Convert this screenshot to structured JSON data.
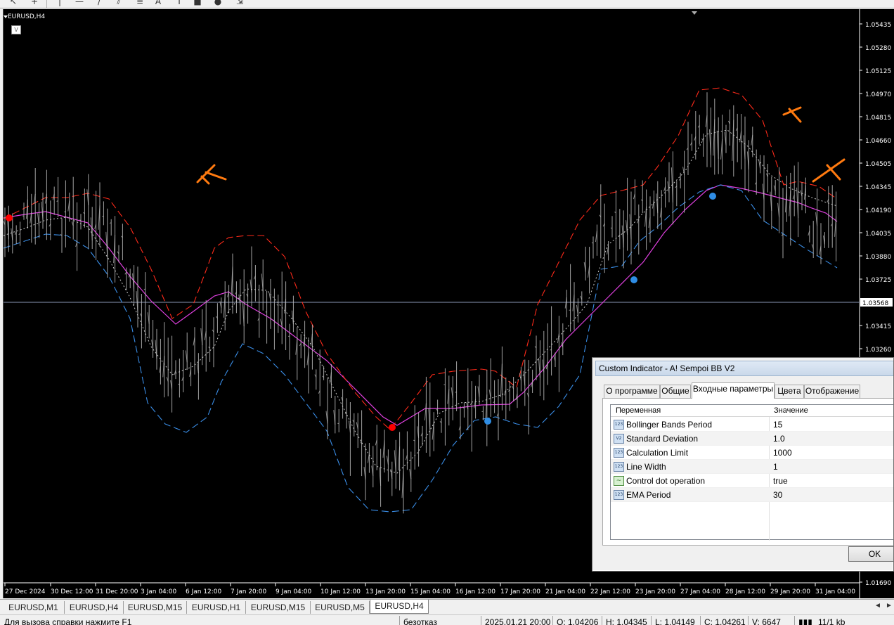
{
  "toolbar": {
    "buttons": [
      {
        "icon": "cursor-icon"
      },
      {
        "icon": "crosshair-icon"
      },
      {
        "icon": "vertical-line-icon"
      },
      {
        "icon": "horizontal-line-icon"
      },
      {
        "icon": "trendline-icon"
      },
      {
        "icon": "equidistant-channel-icon"
      },
      {
        "icon": "fibonacci-icon"
      },
      {
        "icon": "text-icon"
      },
      {
        "icon": "label-icon"
      },
      {
        "icon": "rectangle-icon"
      },
      {
        "icon": "ellipse-icon"
      },
      {
        "icon": "arrows-icon"
      }
    ]
  },
  "chart": {
    "symbol": "EURUSD,H4",
    "one_click_label": "V",
    "current_price": "1.03568",
    "price_axis": [
      "1.05435",
      "1.05280",
      "1.05125",
      "1.04970",
      "1.04815",
      "1.04660",
      "1.04505",
      "1.04345",
      "1.04190",
      "1.04035",
      "1.03880",
      "1.03725",
      "1.03568",
      "1.03415",
      "1.03260",
      "1.01690"
    ],
    "time_axis": [
      "27 Dec 2024",
      "30 Dec 12:00",
      "31 Dec 20:00",
      "3 Jan 04:00",
      "6 Jan 12:00",
      "7 Jan 20:00",
      "9 Jan 04:00",
      "10 Jan 12:00",
      "13 Jan 20:00",
      "15 Jan 04:00",
      "16 Jan 12:00",
      "17 Jan 20:00",
      "21 Jan 04:00",
      "22 Jan 12:00",
      "23 Jan 20:00",
      "27 Jan 04:00",
      "28 Jan 12:00",
      "29 Jan 20:00",
      "31 Jan 04:00"
    ],
    "colors": {
      "background": "#000000",
      "bars": "#c0c0c0",
      "upper_band": "#ff2a1a",
      "lower_band": "#3a8ee8",
      "middle_band": "#c8c8c8",
      "ema": "#e040e0",
      "red_dot": "#ff0000",
      "blue_dot": "#2f8de4",
      "annotation": "#ff7a10"
    }
  },
  "tabs": {
    "items": [
      "EURUSD,M1",
      "EURUSD,H4",
      "EURUSD,M15",
      "EURUSD,H1",
      "EURUSD,M15",
      "EURUSD,M5",
      "EURUSD,H4"
    ],
    "active_index": 6
  },
  "status": {
    "help": "Для вызова справки нажмите F1",
    "profile": "безотказ",
    "datetime": "2025.01.21 20:00",
    "open": "O: 1.04206",
    "high": "H: 1.04345",
    "low": "L: 1.04149",
    "close": "C: 1.04261",
    "volume": "V: 6647",
    "traffic": "11/1 kb"
  },
  "dialog": {
    "title": "Custom Indicator - A! Sempoi BB V2",
    "tabs": [
      "О программе",
      "Общие",
      "Входные параметры",
      "Цвета",
      "Отображение"
    ],
    "active_tab": 2,
    "headers": {
      "variable": "Переменная",
      "value": "Значение"
    },
    "params": [
      {
        "icon": "int-icon",
        "badge": "123",
        "name": "Bollinger Bands Period",
        "value": "15"
      },
      {
        "icon": "double-icon",
        "badge": "V2",
        "name": "Standard Deviation",
        "value": "1.0"
      },
      {
        "icon": "int-icon",
        "badge": "123",
        "name": "Calculation Limit",
        "value": "1000"
      },
      {
        "icon": "int-icon",
        "badge": "123",
        "name": "Line Width",
        "value": "1"
      },
      {
        "icon": "bool-icon",
        "badge": "~",
        "name": "Control dot operation",
        "value": "true"
      },
      {
        "icon": "int-icon",
        "badge": "123",
        "name": "EMA Period",
        "value": "30"
      }
    ],
    "ok_label": "OK"
  }
}
